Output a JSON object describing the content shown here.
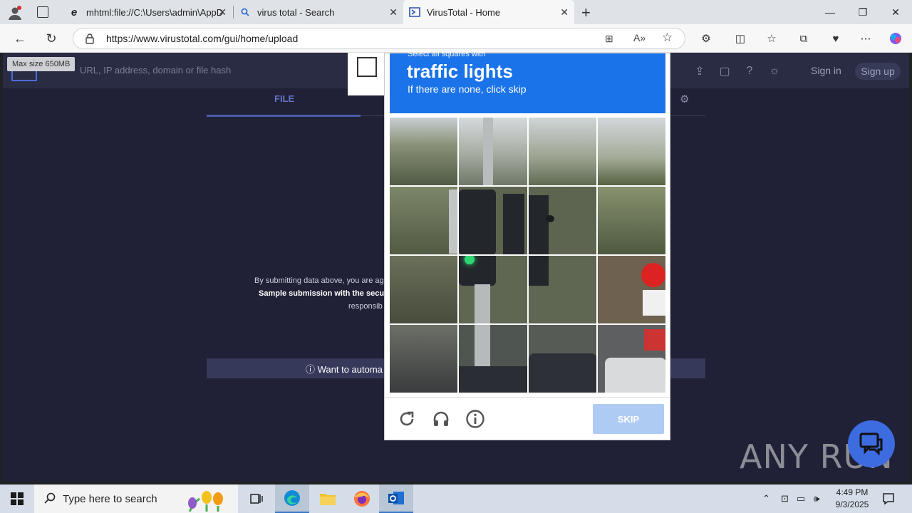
{
  "browser": {
    "tabs": [
      {
        "title": "mhtml:file://C:\\Users\\admin\\AppD",
        "icon": "ie-icon"
      },
      {
        "title": "virus total - Search",
        "icon": "search-icon"
      },
      {
        "title": "VirusTotal - Home",
        "icon": "virustotal-icon"
      }
    ],
    "url": "https://www.virustotal.com/gui/home/upload"
  },
  "page": {
    "maxsize": "Max size 650MB",
    "search_placeholder": "URL, IP address, domain or file hash",
    "signin": "Sign in",
    "signup": "Sign up",
    "file_tab": "FILE",
    "terms_line1": "By submitting data above, you are ag",
    "terms_line2": "Sample submission with the secu",
    "terms_line3": "responsib",
    "automate": "ⓘ Want to automa"
  },
  "captcha": {
    "pre": "Select all squares with",
    "title": "traffic lights",
    "subtitle": "If there are none, click skip",
    "skip": "SKIP"
  },
  "watermark": "ANY RUN",
  "taskbar": {
    "search_placeholder": "Type here to search",
    "time": "4:49 PM",
    "date": "9/3/2025"
  }
}
